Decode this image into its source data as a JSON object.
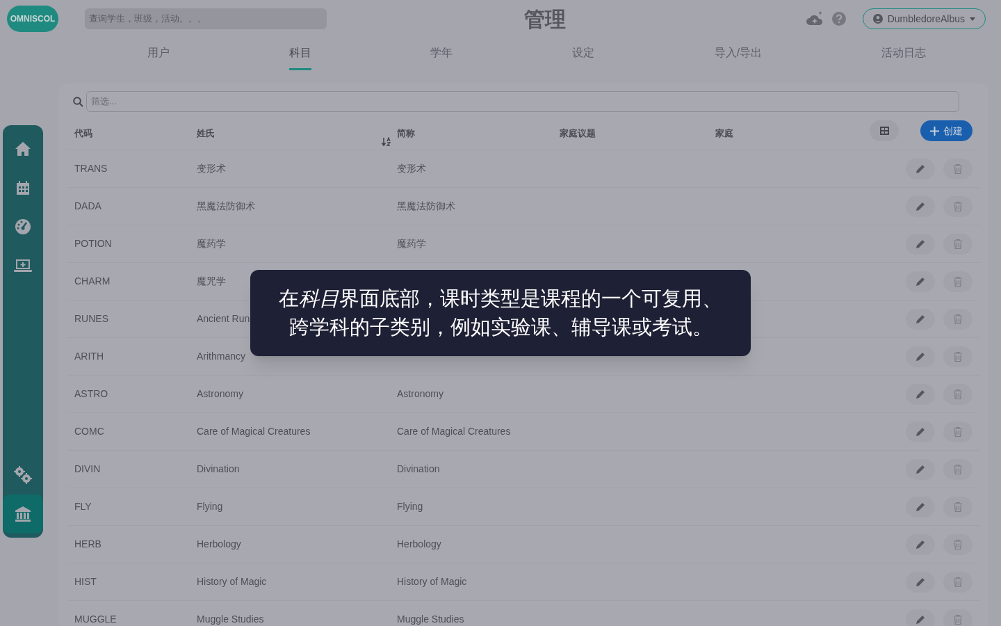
{
  "header": {
    "logo": "OMNISCOL",
    "search": {
      "placeholder": "查询学生，班级，活动。。。"
    },
    "title": "管理",
    "user": "DumbledoreAlbus"
  },
  "tabs": [
    {
      "label": "用户",
      "selected": false
    },
    {
      "label": "科目",
      "selected": true
    },
    {
      "label": "学年",
      "selected": false
    },
    {
      "label": "设定",
      "selected": false
    },
    {
      "label": "导入/导出",
      "selected": false
    },
    {
      "label": "活动日志",
      "selected": false
    }
  ],
  "sidebar": {
    "items": [
      {
        "kind": "home",
        "selected": false
      },
      {
        "kind": "calendar",
        "selected": false
      },
      {
        "kind": "gauge",
        "selected": false
      },
      {
        "kind": "laptop",
        "selected": false
      },
      {
        "kind": "gears",
        "selected": false
      },
      {
        "kind": "bank",
        "selected": true
      }
    ]
  },
  "table": {
    "filter": {
      "placeholder": "筛选..."
    },
    "columns": [
      "代码",
      "姓氏",
      "简称",
      "家庭议题",
      "家庭"
    ],
    "create_button": "创建",
    "rows": [
      {
        "code": "TRANS",
        "name": "变形术",
        "short": "变形术"
      },
      {
        "code": "DADA",
        "name": "黑魔法防御术",
        "short": "黑魔法防御术"
      },
      {
        "code": "POTION",
        "name": "魔药学",
        "short": "魔药学"
      },
      {
        "code": "CHARM",
        "name": "魔咒学"
      },
      {
        "code": "RUNES",
        "name": "Ancient Run"
      },
      {
        "code": "ARITH",
        "name": "Arithmancy"
      },
      {
        "code": "ASTRO",
        "name": "Astronomy",
        "short": "Astronomy"
      },
      {
        "code": "COMC",
        "name": "Care of Magical Creatures",
        "short": "Care of Magical Creatures"
      },
      {
        "code": "DIVIN",
        "name": "Divination",
        "short": "Divination"
      },
      {
        "code": "FLY",
        "name": "Flying",
        "short": "Flying"
      },
      {
        "code": "HERB",
        "name": "Herbology",
        "short": "Herbology"
      },
      {
        "code": "HIST",
        "name": "History of Magic",
        "short": "History of Magic"
      },
      {
        "code": "MUGGLE",
        "name": "Muggle Studies",
        "short": "Muggle Studies"
      }
    ]
  },
  "caption": [
    {
      "text": "在",
      "italic": false
    },
    {
      "text": "科目",
      "italic": true
    },
    {
      "text": "界面底部，课时类型是课程的一个可复用、跨学科的子类别，例如实验课、辅导课或考试。",
      "italic": false
    }
  ]
}
